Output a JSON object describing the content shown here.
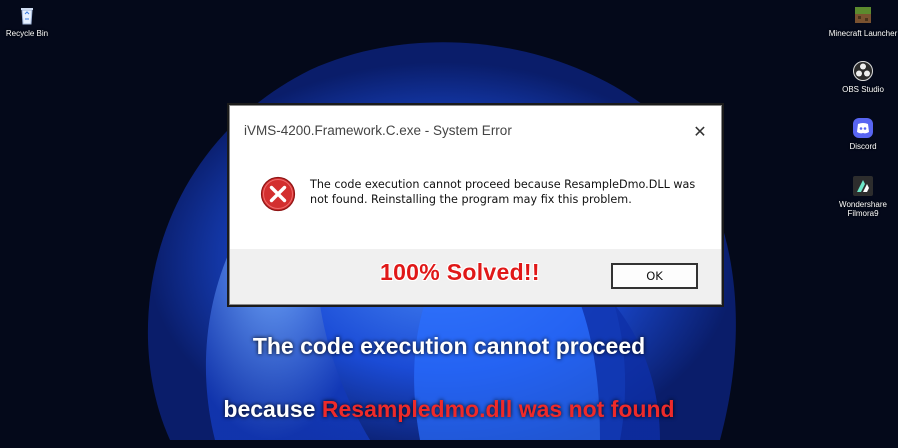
{
  "desktop": {
    "icons": [
      {
        "label": "Recycle Bin",
        "icon": "recycle-bin-icon"
      },
      {
        "label": "Minecraft Launcher",
        "icon": "minecraft-icon"
      },
      {
        "label": "OBS Studio",
        "icon": "obs-icon"
      },
      {
        "label": "Discord",
        "icon": "discord-icon"
      },
      {
        "label": "Wondershare Filmora9",
        "icon": "filmora-icon"
      }
    ]
  },
  "dialog": {
    "title": "iVMS-4200.Framework.C.exe - System Error",
    "close_glyph": "✕",
    "message": "The code execution cannot proceed because ResampleDmo.DLL was not found. Reinstalling the program may fix this problem.",
    "ok_label": "OK",
    "error_icon": "error-icon"
  },
  "overlay": {
    "solved_text": "100% Solved!!",
    "caption_line1": "The code execution cannot proceed",
    "caption_line2_prefix": "because ",
    "caption_line2_highlight": "Resampledmo.dll was not found"
  },
  "colors": {
    "highlight_red": "#ee2a2a",
    "error_red": "#d32f2f",
    "wallpaper_blue": "#1f5eff"
  }
}
